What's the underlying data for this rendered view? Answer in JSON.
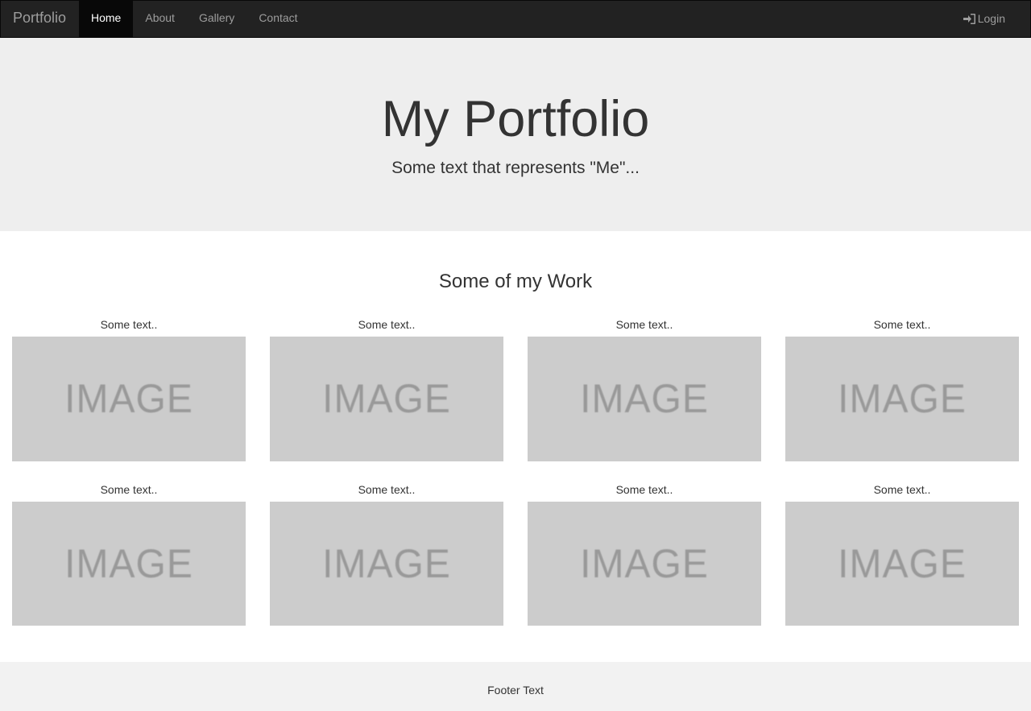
{
  "navbar": {
    "brand": "Portfolio",
    "items": [
      {
        "label": "Home",
        "active": true
      },
      {
        "label": "About",
        "active": false
      },
      {
        "label": "Gallery",
        "active": false
      },
      {
        "label": "Contact",
        "active": false
      }
    ],
    "login_label": "Login",
    "login_icon": "log-in-icon"
  },
  "jumbotron": {
    "title": "My Portfolio",
    "subtitle": "Some text that represents \"Me\"..."
  },
  "work": {
    "title": "Some of my Work",
    "cards": [
      {
        "caption": "Some text..",
        "image_text": "IMAGE"
      },
      {
        "caption": "Some text..",
        "image_text": "IMAGE"
      },
      {
        "caption": "Some text..",
        "image_text": "IMAGE"
      },
      {
        "caption": "Some text..",
        "image_text": "IMAGE"
      },
      {
        "caption": "Some text..",
        "image_text": "IMAGE"
      },
      {
        "caption": "Some text..",
        "image_text": "IMAGE"
      },
      {
        "caption": "Some text..",
        "image_text": "IMAGE"
      },
      {
        "caption": "Some text..",
        "image_text": "IMAGE"
      }
    ]
  },
  "footer": {
    "text": "Footer Text"
  },
  "colors": {
    "navbar_bg": "#222222",
    "nav_active_bg": "#080808",
    "jumbotron_bg": "#eeeeee",
    "image_placeholder": "#cccccc",
    "footer_bg": "#f2f2f2"
  }
}
